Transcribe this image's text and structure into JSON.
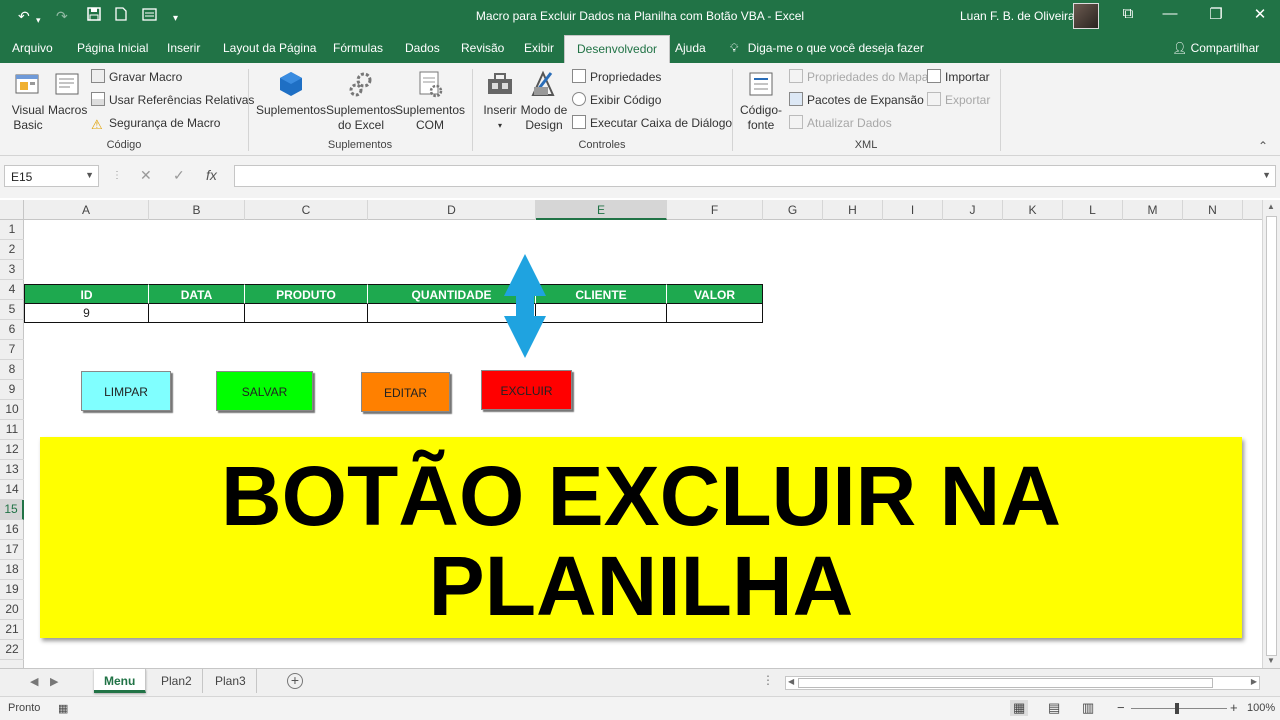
{
  "window": {
    "title": "Macro para Excluir Dados na Planilha com Botão VBA  -  Excel",
    "user": "Luan F. B. de Oliveira"
  },
  "quick_access": {
    "undo_icon": "undo-icon",
    "redo_icon": "redo-icon",
    "save_icon": "save-icon",
    "new_icon": "new-file-icon",
    "form_icon": "form-icon",
    "more_icon": "chevron-down-icon"
  },
  "tabs": [
    "Arquivo",
    "Página Inicial",
    "Inserir",
    "Layout da Página",
    "Fórmulas",
    "Dados",
    "Revisão",
    "Exibir",
    "Desenvolvedor",
    "Ajuda"
  ],
  "active_tab": "Desenvolvedor",
  "tell_me": "Diga-me o que você deseja fazer",
  "share": "Compartilhar",
  "ribbon": {
    "codigo": {
      "label": "Código",
      "visual_basic": "Visual\nBasic",
      "macros": "Macros",
      "gravar_macro": "Gravar Macro",
      "usar_ref": "Usar Referências Relativas",
      "seguranca": "Segurança de Macro"
    },
    "suplementos": {
      "label": "Suplementos",
      "suplementos": "Suplementos",
      "suplementos_excel": "Suplementos\ndo Excel",
      "suplementos_com": "Suplementos\nCOM"
    },
    "controles": {
      "label": "Controles",
      "inserir": "Inserir",
      "modo_design": "Modo de\nDesign",
      "propriedades": "Propriedades",
      "exibir_codigo": "Exibir Código",
      "executar_caixa": "Executar Caixa de Diálogo"
    },
    "xml": {
      "label": "XML",
      "codigo_fonte": "Código-\nfonte",
      "propriedades_mapa": "Propriedades do Mapa",
      "pacotes": "Pacotes de Expansão",
      "atualizar": "Atualizar Dados",
      "importar": "Importar",
      "exportar": "Exportar"
    }
  },
  "name_box": "E15",
  "formula_value": "",
  "columns": [
    "A",
    "B",
    "C",
    "D",
    "E",
    "F",
    "G",
    "H",
    "I",
    "J",
    "K",
    "L",
    "M",
    "N"
  ],
  "selected_column": "E",
  "rows": [
    "1",
    "2",
    "3",
    "4",
    "5",
    "6",
    "7",
    "8",
    "9",
    "10",
    "11",
    "12",
    "13",
    "14",
    "15",
    "16",
    "17",
    "18",
    "19",
    "20",
    "21",
    "22"
  ],
  "selected_row": "15",
  "table": {
    "headers": [
      "ID",
      "DATA",
      "PRODUTO",
      "QUANTIDADE",
      "CLIENTE",
      "VALOR"
    ],
    "row": [
      "9",
      "",
      "",
      "",
      "",
      ""
    ]
  },
  "buttons": {
    "limpar": "LIMPAR",
    "salvar": "SALVAR",
    "editar": "EDITAR",
    "excluir": "EXCLUIR"
  },
  "banner": {
    "line1": "BOTÃO EXCLUIR NA",
    "line2": "PLANILHA"
  },
  "sheets": [
    "Menu",
    "Plan2",
    "Plan3"
  ],
  "active_sheet": "Menu",
  "status": {
    "ready": "Pronto",
    "zoom": "100%"
  },
  "colors": {
    "excel_green": "#217346",
    "header_green": "#1ea94f",
    "limpar": "#80ffff",
    "salvar": "#00ff00",
    "editar": "#ff8000",
    "excluir": "#ff0000",
    "banner": "#ffff00",
    "arrow": "#1fa3e0"
  }
}
